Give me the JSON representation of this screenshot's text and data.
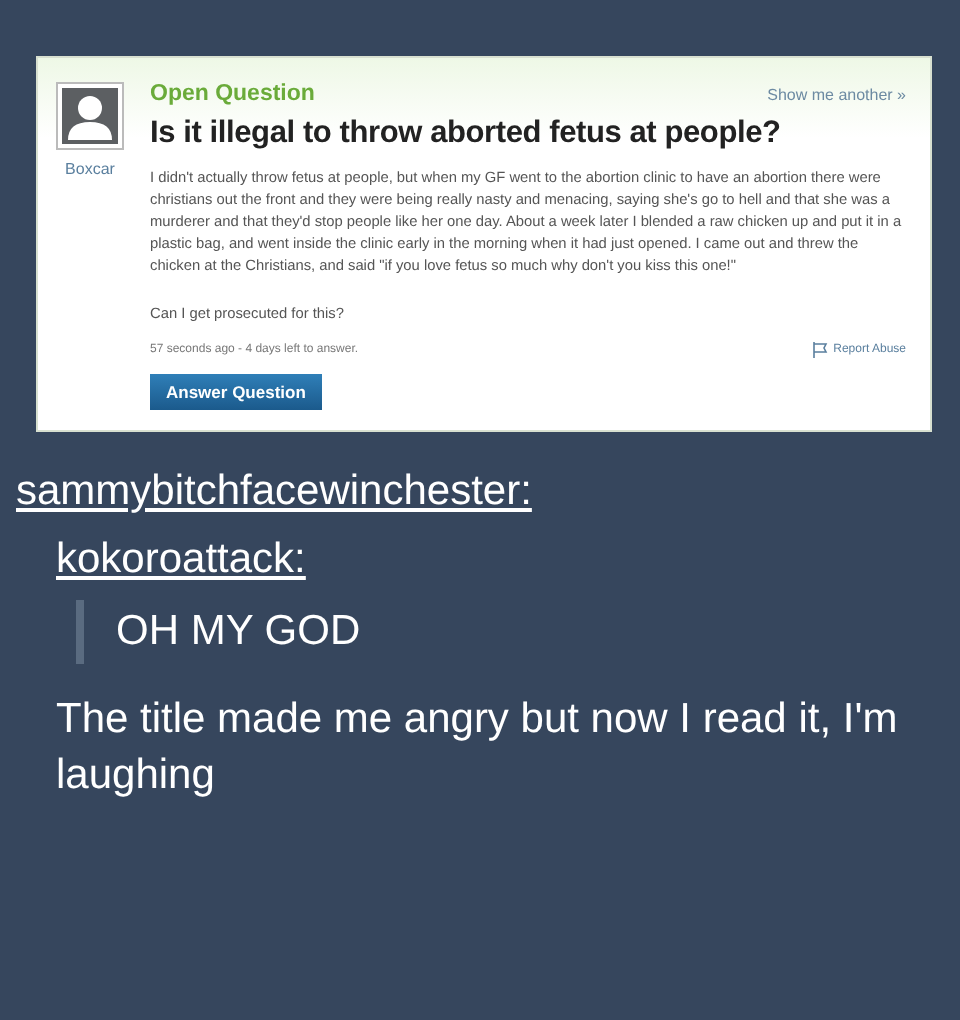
{
  "question": {
    "user": "Boxcar",
    "status": "Open Question",
    "show_another": "Show me another »",
    "title": "Is it illegal to throw aborted fetus at people?",
    "body": [
      "I didn't actually throw fetus at people, but when my GF went to the abortion clinic to have an abortion there were christians out the front and they were being really nasty and menacing, saying she's go to hell and that she was a murderer and that they'd stop people like her one day. About a week later I blended a raw chicken up and put it in a plastic bag, and went inside the clinic early in the morning when it had just opened. I came out and threw the chicken at the Christians, and said \"if you love fetus so much why don't you kiss this one!\"",
      "Can I get prosecuted for this?"
    ],
    "meta": "57 seconds ago - 4 days left to answer.",
    "report": "Report Abuse",
    "answer_button": "Answer Question"
  },
  "reblogs": [
    {
      "username": "sammybitchfacewinchester:"
    },
    {
      "username": "kokoroattack:",
      "quote": "OH MY GOD"
    }
  ],
  "comment": "The title made me angry but now I read it, I'm laughing"
}
